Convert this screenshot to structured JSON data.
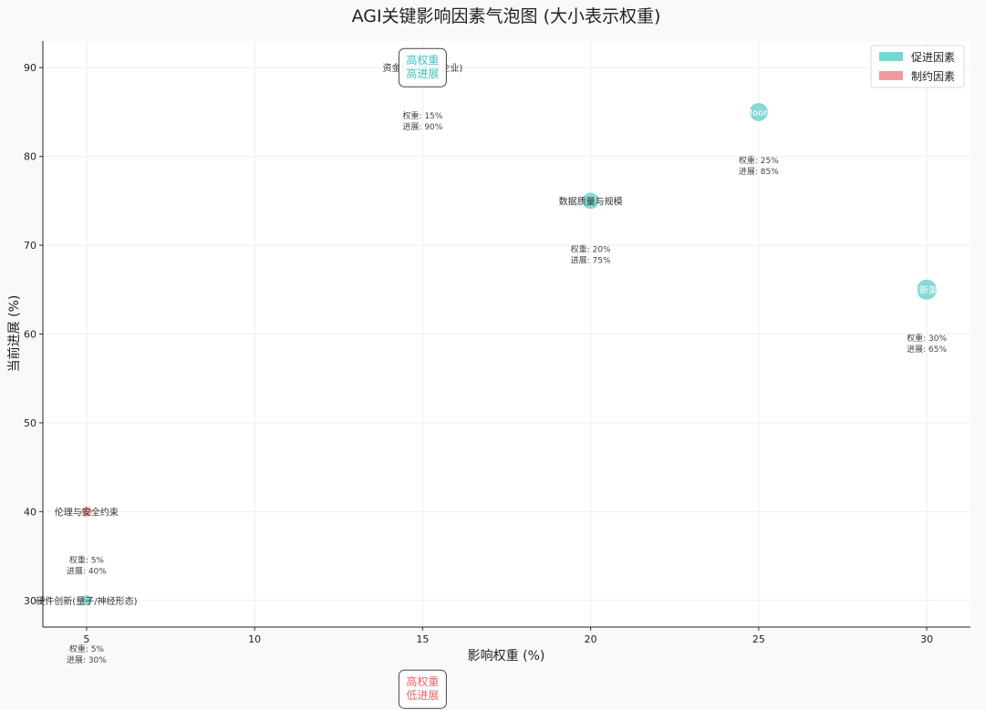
{
  "chart_data": {
    "type": "scatter",
    "title": "AGI关键影响因素气泡图 (大小表示权重)",
    "xlabel": "影响权重 (%)",
    "ylabel": "当前进展 (%)",
    "xlim": [
      3.7,
      31.3
    ],
    "ylim": [
      27,
      93
    ],
    "xticks": [
      5,
      10,
      15,
      20,
      25,
      30
    ],
    "yticks": [
      30,
      40,
      50,
      60,
      70,
      80,
      90
    ],
    "grid": true,
    "legend": {
      "placement": "top-right",
      "entries": [
        {
          "label": "促进因素",
          "color": "#79d5d0"
        },
        {
          "label": "制约因素",
          "color": "#f4989b"
        }
      ]
    },
    "points": [
      {
        "name": "资金投入(企业)",
        "label": "资金投入(科技企业)",
        "x": 15,
        "y": 90,
        "category": "促进因素",
        "info": [
          "权重: 15%",
          "进展: 90%"
        ]
      },
      {
        "name": "Moore",
        "label": "Moore",
        "x": 25,
        "y": 85,
        "category": "促进因素",
        "info": [
          "权重: 25%",
          "进展: 85%"
        ]
      },
      {
        "name": "数据质量与规模",
        "label": "数据质量与规模",
        "x": 20,
        "y": 75,
        "category": "促进因素",
        "info": [
          "权重: 20%",
          "进展: 75%"
        ]
      },
      {
        "name": "新架构",
        "label": "(新架",
        "x": 30,
        "y": 65,
        "category": "促进因素",
        "info": [
          "权重: 30%",
          "进展: 65%"
        ]
      },
      {
        "name": "伦理与安全约束",
        "label": "伦理与安全约束",
        "x": 5,
        "y": 40,
        "category": "制约因素",
        "info": [
          "权重: 5%",
          "进展: 40%"
        ]
      },
      {
        "name": "硬件创新(量子/神经形态)",
        "label": "硬件创新(量子/神经形态)",
        "x": 5,
        "y": 30,
        "category": "促进因素",
        "info": [
          "权重: 5%",
          "进展: 30%"
        ]
      }
    ],
    "annotations": [
      {
        "lines": [
          "高权重",
          "高进展"
        ],
        "color": "#3fc4bd",
        "x": 15,
        "y": 90
      },
      {
        "lines": [
          "高权重",
          "低进展"
        ],
        "color": "#e8676a",
        "x": 15,
        "y": 20
      }
    ]
  }
}
